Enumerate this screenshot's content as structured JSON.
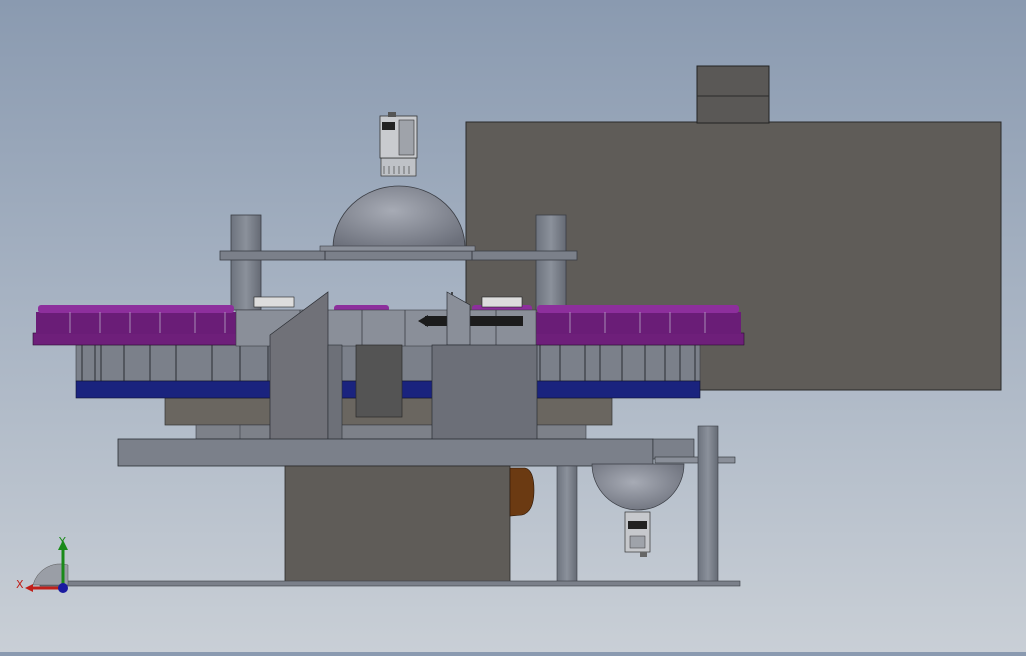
{
  "triad": {
    "x_label": "X",
    "y_label": "Y",
    "colors": {
      "x": "#c0201a",
      "y": "#1a8a1a",
      "z": "#1a1aa0"
    }
  },
  "colors": {
    "background_top": "#8a9ab0",
    "background_bottom": "#c9cfd6",
    "cabinet": "#5e5b57",
    "frame": "#7c8088",
    "conveyor_band": "#1a237e",
    "bottle_caps": "#7b1f87",
    "dome": "#7d8290",
    "bronze_part": "#6b3a12"
  }
}
